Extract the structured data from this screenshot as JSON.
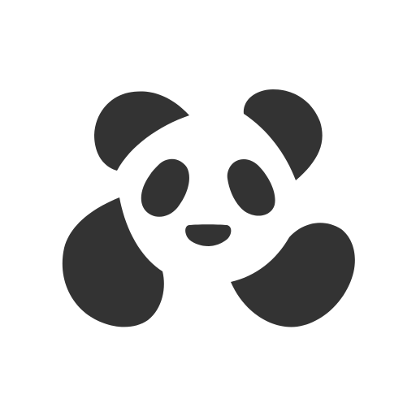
{
  "logo": {
    "icon": "panda-icon",
    "ink_color": "#333333",
    "background_color": "#ffffff"
  }
}
